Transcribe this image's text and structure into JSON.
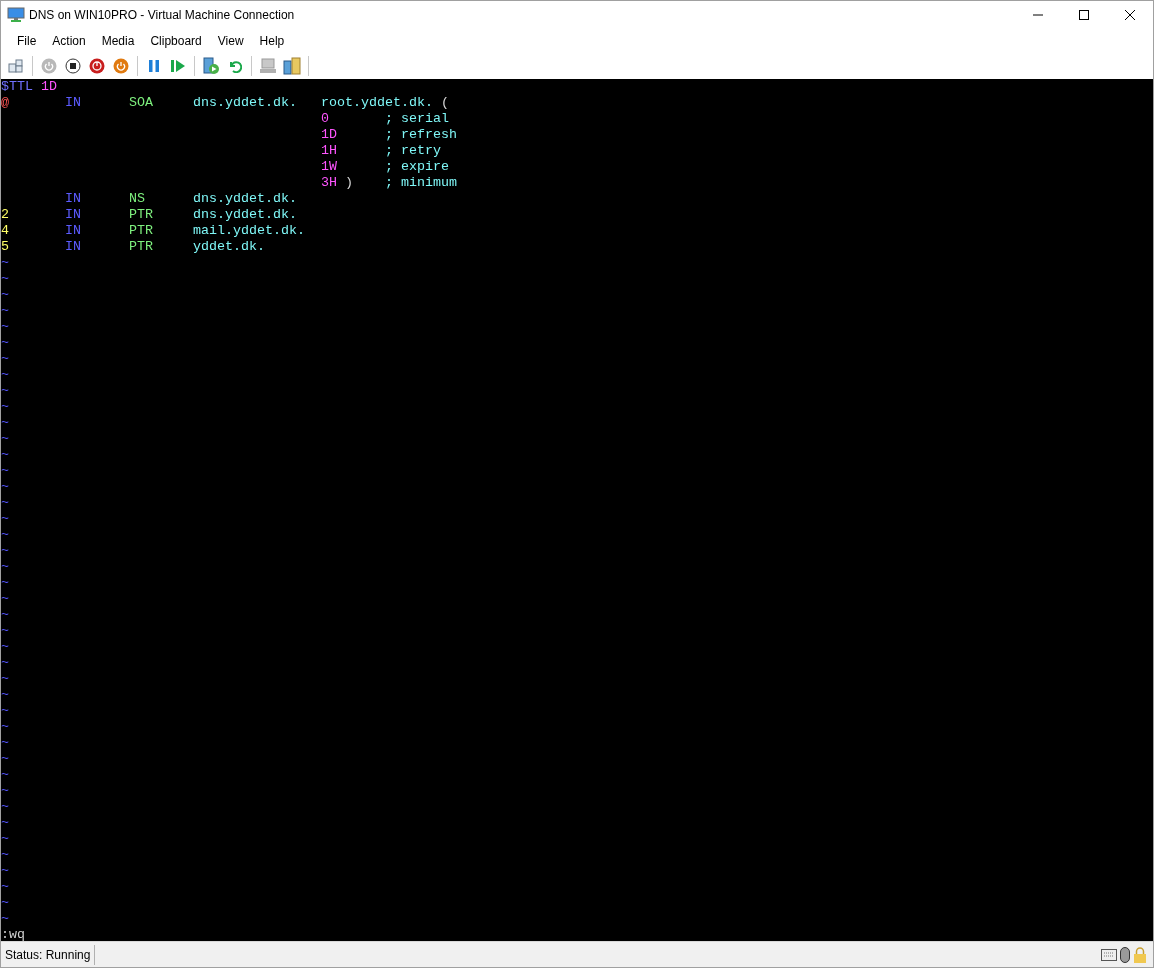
{
  "window": {
    "title": "DNS on WIN10PRO - Virtual Machine Connection"
  },
  "menu": [
    "File",
    "Action",
    "Media",
    "Clipboard",
    "View",
    "Help"
  ],
  "terminal": {
    "lines": [
      {
        "name": [
          {
            "text": "$TTL",
            "kind": "directive"
          },
          {
            "text": "1D",
            "kind": "number"
          }
        ]
      },
      {
        "name": [
          {
            "text": "@",
            "kind": "origin"
          }
        ],
        "class": [
          {
            "text": "IN",
            "kind": "class"
          }
        ],
        "type": [
          {
            "text": "SOA",
            "kind": "type"
          }
        ],
        "rdata": [
          {
            "text": "dns.yddet.dk.",
            "kind": "data"
          }
        ],
        "value": [
          {
            "text": "root.yddet.dk.",
            "kind": "data"
          },
          {
            "text": "(",
            "kind": "plain"
          }
        ]
      },
      {
        "value": [
          {
            "text": "0",
            "kind": "number"
          }
        ],
        "comment": [
          {
            "text": "; serial",
            "kind": "comment"
          }
        ]
      },
      {
        "value": [
          {
            "text": "1D",
            "kind": "number"
          }
        ],
        "comment": [
          {
            "text": "; refresh",
            "kind": "comment"
          }
        ]
      },
      {
        "value": [
          {
            "text": "1H",
            "kind": "number"
          }
        ],
        "comment": [
          {
            "text": "; retry",
            "kind": "comment"
          }
        ]
      },
      {
        "value": [
          {
            "text": "1W",
            "kind": "number"
          }
        ],
        "comment": [
          {
            "text": "; expire",
            "kind": "comment"
          }
        ]
      },
      {
        "value": [
          {
            "text": "3H",
            "kind": "number"
          },
          {
            "text": ")",
            "kind": "plain"
          }
        ],
        "comment": [
          {
            "text": "; minimum",
            "kind": "comment"
          }
        ]
      },
      {
        "class": [
          {
            "text": "IN",
            "kind": "class"
          }
        ],
        "type": [
          {
            "text": "NS",
            "kind": "type"
          }
        ],
        "rdata": [
          {
            "text": "dns.yddet.dk.",
            "kind": "data"
          }
        ]
      },
      {
        "name": [
          {
            "text": "2",
            "kind": "name"
          }
        ],
        "class": [
          {
            "text": "IN",
            "kind": "class"
          }
        ],
        "type": [
          {
            "text": "PTR",
            "kind": "type"
          }
        ],
        "rdata": [
          {
            "text": "dns.yddet.dk.",
            "kind": "data"
          }
        ]
      },
      {
        "name": [
          {
            "text": "4",
            "kind": "name"
          }
        ],
        "class": [
          {
            "text": "IN",
            "kind": "class"
          }
        ],
        "type": [
          {
            "text": "PTR",
            "kind": "type"
          }
        ],
        "rdata": [
          {
            "text": "mail.yddet.dk.",
            "kind": "data"
          }
        ]
      },
      {
        "name": [
          {
            "text": "5",
            "kind": "name"
          }
        ],
        "class": [
          {
            "text": "IN",
            "kind": "class"
          }
        ],
        "type": [
          {
            "text": "PTR",
            "kind": "type"
          }
        ],
        "rdata": [
          {
            "text": "yddet.dk.",
            "kind": "data"
          }
        ]
      }
    ],
    "empty_line_markers": [
      "~",
      "~",
      "~",
      "~",
      "~",
      "~",
      "~",
      "~",
      "~",
      "~",
      "~",
      "~",
      "~",
      "~",
      "~",
      "~",
      "~",
      "~",
      "~",
      "~",
      "~",
      "~",
      "~",
      "~",
      "~",
      "~",
      "~",
      "~",
      "~",
      "~",
      "~",
      "~",
      "~",
      "~",
      "~",
      "~",
      "~",
      "~",
      "~",
      "~",
      "~",
      "~"
    ],
    "command": ":wq"
  },
  "status_bar": {
    "status": "Status: Running"
  }
}
